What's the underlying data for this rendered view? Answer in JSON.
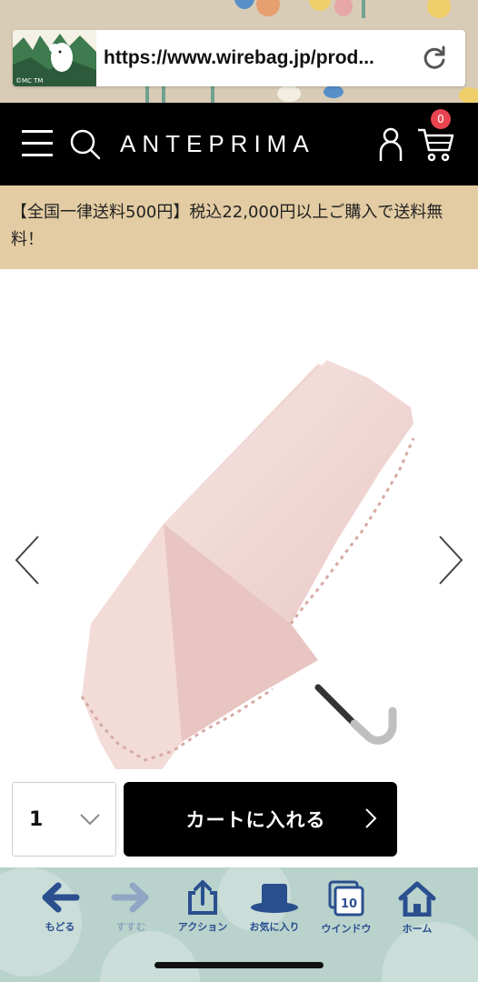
{
  "browser": {
    "url": "https://www.wirebag.jp/prod...",
    "favicon_caption": "©MC TM"
  },
  "header": {
    "brand": "ANTEPRIMA",
    "cart_count": "0"
  },
  "notice": {
    "text": "【全国一律送料500円】税込22,000円以上ご購入で送料無料！"
  },
  "purchase": {
    "quantity": "1",
    "add_to_cart_label": "カートに入れる"
  },
  "toolbar": {
    "items": [
      {
        "label": "もどる"
      },
      {
        "label": "すすむ"
      },
      {
        "label": "アクション"
      },
      {
        "label": "お気に入り"
      },
      {
        "label": "ウインドウ"
      },
      {
        "label": "ホーム"
      }
    ],
    "window_count": "10"
  },
  "colors": {
    "header_bg": "#000000",
    "notice_bg": "#e3cca3",
    "badge": "#e8444f",
    "toolbar_bg": "#b9d2cc",
    "toolbar_icon": "#2a4f8f"
  }
}
